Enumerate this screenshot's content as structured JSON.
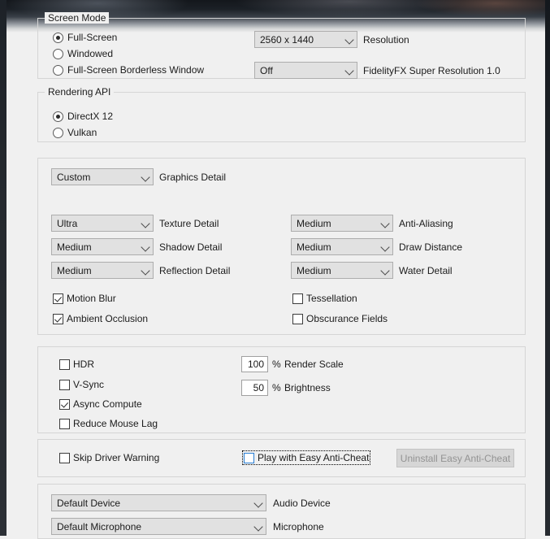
{
  "screen_mode": {
    "title": "Screen Mode",
    "options": [
      {
        "label": "Full-Screen",
        "selected": true
      },
      {
        "label": "Windowed",
        "selected": false
      },
      {
        "label": "Full-Screen Borderless Window",
        "selected": false
      }
    ],
    "resolution": {
      "value": "2560 x 1440",
      "label": "Resolution"
    },
    "fsr": {
      "value": "Off",
      "label": "FidelityFX Super Resolution 1.0"
    }
  },
  "rendering_api": {
    "title": "Rendering API",
    "options": [
      {
        "label": "DirectX 12",
        "selected": true
      },
      {
        "label": "Vulkan",
        "selected": false
      }
    ]
  },
  "graphics": {
    "preset": {
      "value": "Custom",
      "label": "Graphics Detail"
    },
    "left_dropdowns": [
      {
        "value": "Ultra",
        "label": "Texture Detail"
      },
      {
        "value": "Medium",
        "label": "Shadow Detail"
      },
      {
        "value": "Medium",
        "label": "Reflection Detail"
      }
    ],
    "right_dropdowns": [
      {
        "value": "Medium",
        "label": "Anti-Aliasing"
      },
      {
        "value": "Medium",
        "label": "Draw Distance"
      },
      {
        "value": "Medium",
        "label": "Water Detail"
      }
    ],
    "left_checks": [
      {
        "label": "Motion Blur",
        "checked": true
      },
      {
        "label": "Ambient Occlusion",
        "checked": true
      }
    ],
    "right_checks": [
      {
        "label": "Tessellation",
        "checked": false
      },
      {
        "label": "Obscurance Fields",
        "checked": false
      }
    ]
  },
  "display": {
    "checks": [
      {
        "label": "HDR",
        "checked": false
      },
      {
        "label": "V-Sync",
        "checked": false
      },
      {
        "label": "Async Compute",
        "checked": true
      },
      {
        "label": "Reduce Mouse Lag",
        "checked": false
      }
    ],
    "fields": [
      {
        "value": "100",
        "unit": "%",
        "label": "Render Scale"
      },
      {
        "value": "50",
        "unit": "%",
        "label": "Brightness"
      }
    ]
  },
  "anticheat": {
    "skip_driver_warning": {
      "label": "Skip Driver Warning",
      "checked": false
    },
    "play_with_eac": {
      "label": "Play with Easy Anti-Cheat",
      "checked": false,
      "focused": true,
      "accent": "#2a7fd4"
    },
    "uninstall_button": {
      "label": "Uninstall Easy Anti-Cheat",
      "disabled": true
    }
  },
  "audio": {
    "device": {
      "value": "Default Device",
      "label": "Audio Device"
    },
    "microphone": {
      "value": "Default Microphone",
      "label": "Microphone"
    }
  },
  "icons": {
    "chevron": "chevron-down-icon"
  }
}
